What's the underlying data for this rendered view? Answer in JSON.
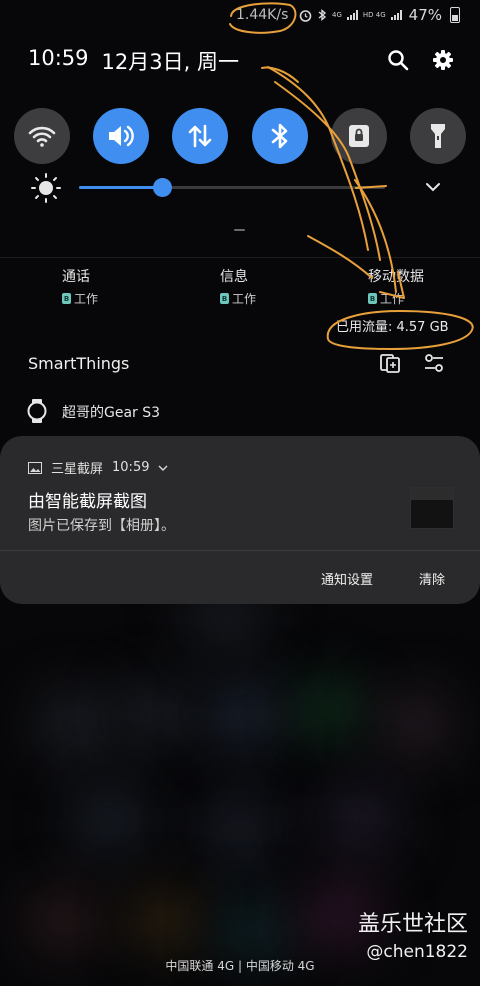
{
  "status_bar": {
    "net_speed": "1.44K/s",
    "sim1_net": "4G",
    "sim2_net": "HD 4G",
    "battery": "47%"
  },
  "header": {
    "time": "10:59",
    "date": "12月3日, 周一"
  },
  "quick_toggles": [
    {
      "name": "wifi",
      "on": false
    },
    {
      "name": "sound",
      "on": true
    },
    {
      "name": "mobile-data",
      "on": true
    },
    {
      "name": "bluetooth",
      "on": true
    },
    {
      "name": "secure-folder",
      "on": false
    },
    {
      "name": "flashlight",
      "on": false
    }
  ],
  "brightness": {
    "level": 0.27
  },
  "sim_row": {
    "cols": [
      {
        "title": "通话",
        "sim": "工作"
      },
      {
        "title": "信息",
        "sim": "工作"
      },
      {
        "title": "移动数据",
        "sim": "工作"
      }
    ],
    "usage": "已用流量: 4.57 GB"
  },
  "smartthings": {
    "title": "SmartThings",
    "device": "超哥的Gear S3"
  },
  "notification": {
    "app": "三星截屏",
    "time": "10:59",
    "title": "由智能截屏截图",
    "body": "图片已保存到【相册】。",
    "actions": [
      "通知设置",
      "清除"
    ]
  },
  "carrier": "中国联通 4G | 中国移动 4G",
  "watermark": {
    "line1": "盖乐世社区",
    "line2": "@chen1822"
  },
  "colors": {
    "accent": "#3f8ef0",
    "annotation": "#e8a03a"
  }
}
